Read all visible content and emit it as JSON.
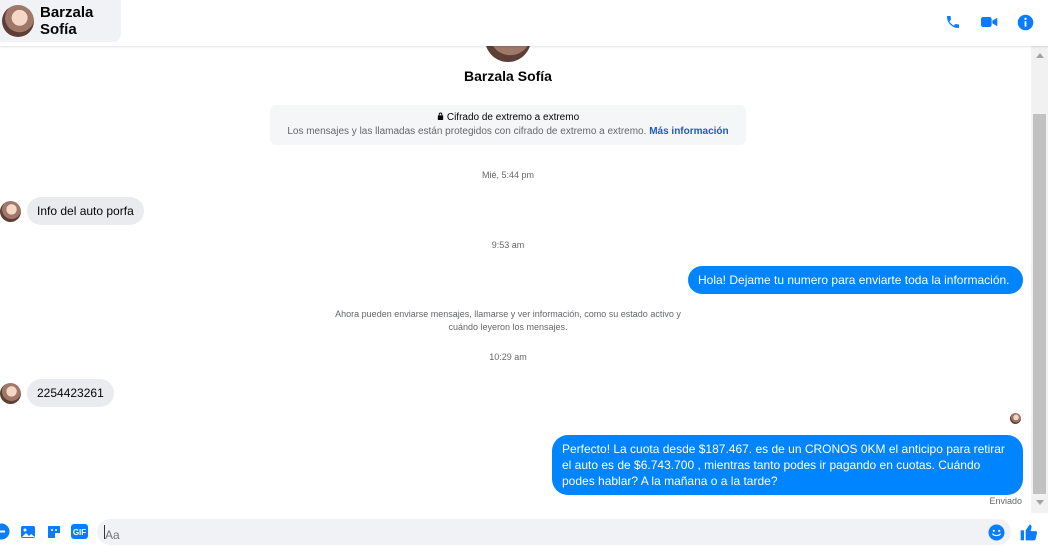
{
  "header": {
    "contact_name": "Barzala Sofía",
    "icons": [
      "phone-icon",
      "video-call-icon",
      "info-icon"
    ]
  },
  "conversation": {
    "contact_name": "Barzala Sofía",
    "e2e_title": "Cifrado de extremo a extremo",
    "e2e_text": "Los mensajes y las llamadas están protegidos con cifrado de extremo a extremo.",
    "e2e_link": "Más información",
    "timestamps": [
      "Mié, 5:44 pm",
      "9:53 am",
      "10:29 am"
    ],
    "system_message": "Ahora pueden enviarse mensajes, llamarse y ver información, como su estado activo y cuándo leyeron los mensajes.",
    "messages": [
      {
        "direction": "in",
        "text": "Info del auto porfa"
      },
      {
        "direction": "out",
        "text": "Hola! Dejame tu numero  para enviarte toda la información."
      },
      {
        "direction": "in",
        "text": "2254423261"
      },
      {
        "direction": "out",
        "text": "Perfecto! La cuota desde $187.467. es de un CRONOS 0KM el anticipo para retirar el auto es de $6.743.700 , mientras tanto podes ir pagando en cuotas. Cuándo podes hablar? A la mañana o a la tarde?"
      }
    ],
    "status": "Enviado"
  },
  "composer": {
    "placeholder": "Aa",
    "gif_label": "GIF",
    "icons": [
      "plus-icon",
      "photo-icon",
      "sticker-icon",
      "gif-icon",
      "emoji-icon",
      "like-icon"
    ]
  },
  "colors": {
    "accent": "#0084ff",
    "icon_blue": "#0a7cff",
    "incoming_bubble": "#e9ebee",
    "secondary_text": "#65676b"
  }
}
